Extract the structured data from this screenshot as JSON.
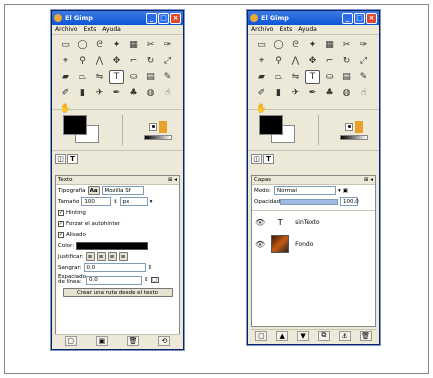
{
  "windows": [
    {
      "title": "El Gimp",
      "menu": [
        "Archivo",
        "Exts",
        "Ayuda"
      ],
      "panel_title": "Texto",
      "font_label": "Tipografía",
      "font_value": "Mozilla Sf",
      "size_label": "Tamaño",
      "size_value": "100",
      "size_unit": "px",
      "checks": [
        "Hinting",
        "Forzar el autohinter",
        "Alisado"
      ],
      "color_label": "Color:",
      "justify_label": "Justificar:",
      "indent_label": "Sangrar:",
      "indent_value": "0.0",
      "spacing_label": "Espaciado de línea:",
      "spacing_value": "0.0",
      "path_button": "Crear una ruta desde el texto"
    },
    {
      "title": "El Gimp",
      "menu": [
        "Archivo",
        "Exts",
        "Ayuda"
      ],
      "panel_title": "Capas",
      "mode_label": "Modo:",
      "mode_value": "Normal",
      "opacity_label": "Opacidad:",
      "opacity_value": "100,0",
      "layers": [
        "sinTexto",
        "Fondo"
      ]
    }
  ]
}
